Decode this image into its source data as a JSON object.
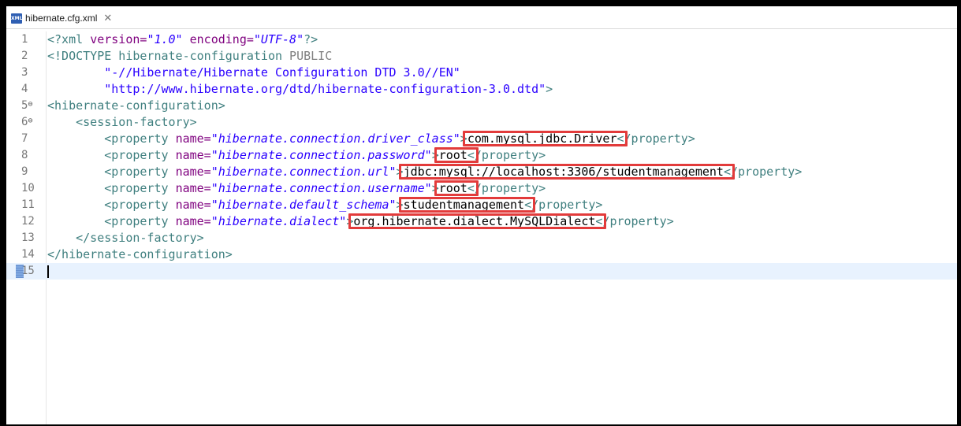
{
  "tab": {
    "filename": "hibernate.cfg.xml",
    "icon": "xml-file-icon",
    "close_glyph": "✕"
  },
  "lines": [
    {
      "num": "1",
      "fold": "",
      "parts": [
        [
          "t",
          "<?xml "
        ],
        [
          "a",
          "version="
        ],
        [
          "v",
          "\"1.0\""
        ],
        [
          "a",
          " encoding="
        ],
        [
          "v",
          "\"UTF-8\""
        ],
        [
          "t",
          "?>"
        ]
      ]
    },
    {
      "num": "2",
      "fold": "",
      "parts": [
        [
          "t",
          "<!DOCTYPE hibernate-configuration "
        ],
        [
          "pub",
          "PUBLIC"
        ]
      ]
    },
    {
      "num": "3",
      "fold": "",
      "parts": [
        [
          "s",
          "        \"-//Hibernate/Hibernate Configuration DTD 3.0//EN\""
        ]
      ]
    },
    {
      "num": "4",
      "fold": "",
      "parts": [
        [
          "s",
          "        \"http://www.hibernate.org/dtd/hibernate-configuration-3.0.dtd\""
        ],
        [
          "t",
          ">"
        ]
      ]
    },
    {
      "num": "5",
      "fold": "⊖",
      "parts": [
        [
          "t",
          "<hibernate-configuration>"
        ]
      ]
    },
    {
      "num": "6",
      "fold": "⊖",
      "parts": [
        [
          "t",
          "    <session-factory>"
        ]
      ]
    },
    {
      "num": "7",
      "fold": "",
      "parts": [
        [
          "t",
          "        <property "
        ],
        [
          "a",
          "name="
        ],
        [
          "v",
          "\"hibernate.connection.driver_class\""
        ],
        [
          "t",
          ">"
        ],
        [
          "txt",
          "com.mysql.jdbc.Driver"
        ],
        [
          "t",
          "</property>"
        ]
      ]
    },
    {
      "num": "8",
      "fold": "",
      "parts": [
        [
          "t",
          "        <property "
        ],
        [
          "a",
          "name="
        ],
        [
          "v",
          "\"hibernate.connection.password\""
        ],
        [
          "t",
          ">"
        ],
        [
          "txt",
          "root"
        ],
        [
          "t",
          "</property>"
        ]
      ]
    },
    {
      "num": "9",
      "fold": "",
      "parts": [
        [
          "t",
          "        <property "
        ],
        [
          "a",
          "name="
        ],
        [
          "v",
          "\"hibernate.connection.url\""
        ],
        [
          "t",
          ">"
        ],
        [
          "txt",
          "jdbc:mysql://localhost:3306/studentmanagement"
        ],
        [
          "t",
          "</property>"
        ]
      ]
    },
    {
      "num": "10",
      "fold": "",
      "parts": [
        [
          "t",
          "        <property "
        ],
        [
          "a",
          "name="
        ],
        [
          "v",
          "\"hibernate.connection.username\""
        ],
        [
          "t",
          ">"
        ],
        [
          "txt",
          "root"
        ],
        [
          "t",
          "</property>"
        ]
      ]
    },
    {
      "num": "11",
      "fold": "",
      "parts": [
        [
          "t",
          "        <property "
        ],
        [
          "a",
          "name="
        ],
        [
          "v",
          "\"hibernate.default_schema\""
        ],
        [
          "t",
          ">"
        ],
        [
          "txt",
          "studentmanagement"
        ],
        [
          "t",
          "</property>"
        ]
      ]
    },
    {
      "num": "12",
      "fold": "",
      "parts": [
        [
          "t",
          "        <property "
        ],
        [
          "a",
          "name="
        ],
        [
          "v",
          "\"hibernate.dialect\""
        ],
        [
          "t",
          ">"
        ],
        [
          "txt",
          "org.hibernate.dialect.MySQLDialect"
        ],
        [
          "t",
          "</property>"
        ]
      ]
    },
    {
      "num": "13",
      "fold": "",
      "parts": [
        [
          "t",
          "    </session-factory>"
        ]
      ]
    },
    {
      "num": "14",
      "fold": "",
      "parts": [
        [
          "t",
          "</hibernate-configuration>"
        ]
      ]
    },
    {
      "num": "15",
      "fold": "",
      "parts": []
    }
  ],
  "colors": {
    "tag": "#3f7f7f",
    "attr": "#7f007f",
    "value": "#2a00ff",
    "highlight_box": "#e23b3b",
    "current_line": "#e8f2fe"
  }
}
